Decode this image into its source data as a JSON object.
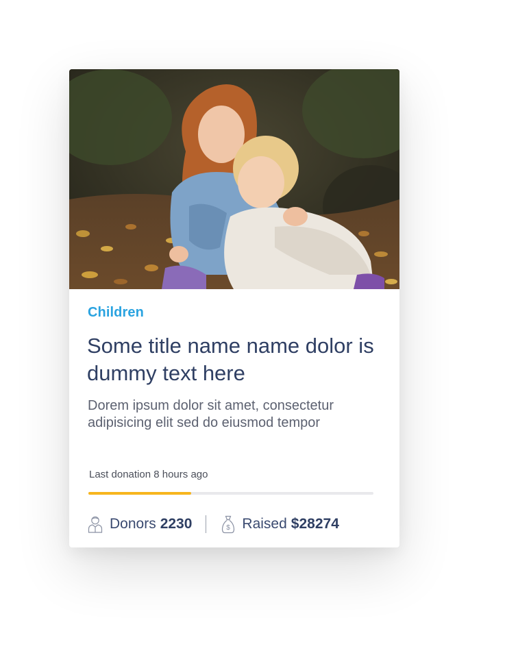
{
  "card": {
    "category": "Children",
    "title": "Some title name name dolor is dummy text here",
    "description": "Dorem ipsum dolor sit amet, consectetur adipisicing elit sed do eiusmod tempor",
    "last_donation": "Last donation 8 hours ago",
    "progress_fraction": 0.36,
    "donors_label": "Donors",
    "donors_value": "2230",
    "raised_label": "Raised",
    "raised_value": "$28274",
    "icons": {
      "donors": "person-icon",
      "raised": "money-bag-icon"
    }
  },
  "colors": {
    "category": "#2aa3e0",
    "title": "#2f3f63",
    "progress_fill": "#f7b51e",
    "progress_track": "#e9e9ec"
  }
}
